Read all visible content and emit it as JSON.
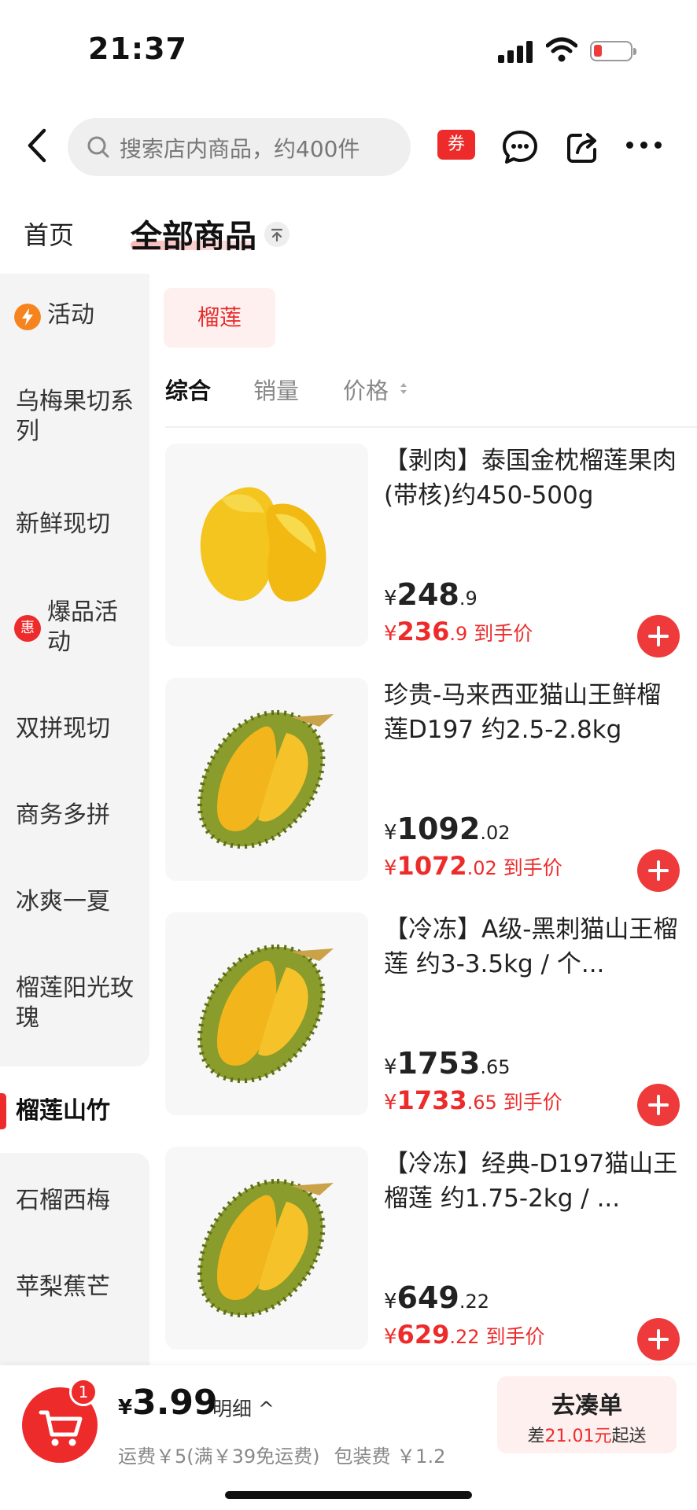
{
  "status_bar": {
    "time": "21:37"
  },
  "header": {
    "search_placeholder": "搜索店内商品，约400件",
    "coupon_label": "券"
  },
  "tabs": {
    "home": "首页",
    "all_products": "全部商品"
  },
  "sidebar": {
    "items": [
      {
        "label": "活动",
        "badge": "lightning"
      },
      {
        "label": "乌梅果切系列"
      },
      {
        "label": "新鲜现切"
      },
      {
        "label": "爆品活动",
        "badge_text": "惠"
      },
      {
        "label": "双拼现切"
      },
      {
        "label": "商务多拼"
      },
      {
        "label": "冰爽一夏"
      },
      {
        "label": "榴莲阳光玫瑰"
      },
      {
        "label": "榴莲山竹",
        "active": true
      },
      {
        "label": "石榴西梅"
      },
      {
        "label": "苹梨蕉芒"
      }
    ]
  },
  "filter_chip": "榴莲",
  "sort": {
    "comprehensive": "综合",
    "sales": "销量",
    "price": "价格"
  },
  "products": [
    {
      "title": "【剥肉】泰国金枕榴莲果肉(带核)约450-500g",
      "price_currency": "¥",
      "price_int": "248",
      "price_dec": ".9",
      "final_int": "236",
      "final_dec": ".9",
      "final_label": "到手价",
      "image": "durian-flesh"
    },
    {
      "title": "珍贵-马来西亚猫山王鲜榴莲D197 约2.5-2.8kg",
      "price_currency": "¥",
      "price_int": "1092",
      "price_dec": ".02",
      "final_int": "1072",
      "final_dec": ".02",
      "final_label": "到手价",
      "image": "durian-whole"
    },
    {
      "title": "【冷冻】A级-黑刺猫山王榴莲 约3-3.5kg / 个...",
      "price_currency": "¥",
      "price_int": "1753",
      "price_dec": ".65",
      "final_int": "1733",
      "final_dec": ".65",
      "final_label": "到手价",
      "image": "durian-whole"
    },
    {
      "title": "【冷冻】经典-D197猫山王榴莲 约1.75-2kg / ...",
      "price_currency": "¥",
      "price_int": "649",
      "price_dec": ".22",
      "final_int": "629",
      "final_dec": ".22",
      "final_label": "到手价",
      "image": "durian-whole"
    }
  ],
  "bottom_bar": {
    "cart_count": "1",
    "total_currency": "¥",
    "total_amount": "3.99",
    "detail_label": "明细",
    "shipping_fee": "运费￥5(满￥39免运费)",
    "packing_fee": "包装费 ￥1.2",
    "go_button": "去凑单",
    "go_sub_prefix": "差",
    "go_sub_amount": "21.01元",
    "go_sub_suffix": "起送"
  },
  "colors": {
    "accent": "#ee2b2b",
    "chip_bg": "#fdf0ef",
    "sidebar_bg": "#f4f4f4"
  }
}
